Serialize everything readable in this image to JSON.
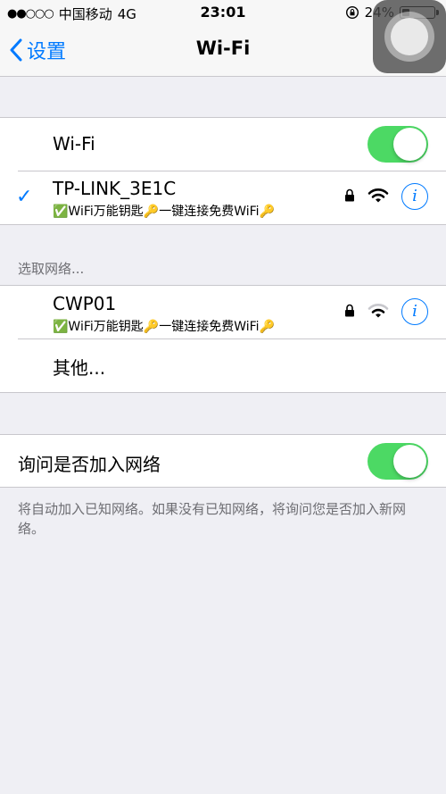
{
  "status_bar": {
    "signal_dots": "●●○○○",
    "carrier": "中国移动",
    "network": "4G",
    "time": "23:01",
    "battery_percent": "24%",
    "battery_level": 0.24
  },
  "nav": {
    "back_label": "设置",
    "title": "Wi-Fi"
  },
  "wifi_toggle": {
    "label": "Wi-Fi",
    "on": true
  },
  "connected_network": {
    "name": "TP-LINK_3E1C",
    "subtitle": "✅WiFi万能钥匙🔑一键连接免费WiFi🔑"
  },
  "choose_network_header": "选取网络...",
  "networks": [
    {
      "name": "CWP01",
      "subtitle": "✅WiFi万能钥匙🔑一键连接免费WiFi🔑"
    }
  ],
  "other_label": "其他...",
  "ask_to_join": {
    "label": "询问是否加入网络",
    "on": true
  },
  "footer": "将自动加入已知网络。如果没有已知网络，将询问您是否加入新网络。",
  "colors": {
    "accent": "#007aff",
    "toggle_on": "#4cd964",
    "background": "#efeff4"
  }
}
